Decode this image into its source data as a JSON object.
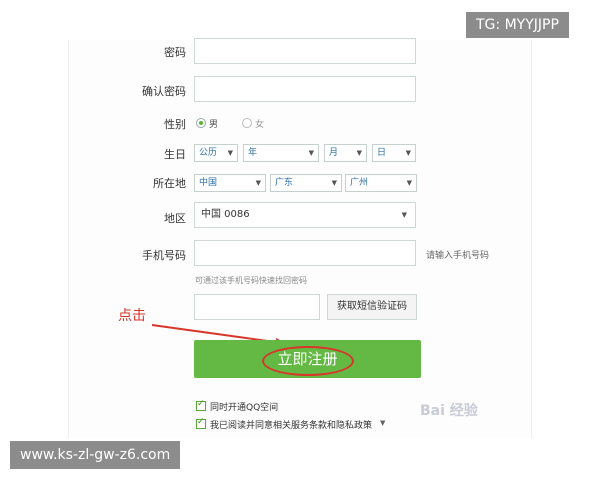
{
  "form": {
    "password_label": "密码",
    "confirm_password_label": "确认密码",
    "gender_label": "性别",
    "gender_male": "男",
    "gender_female": "女",
    "birthday_label": "生日",
    "calendar": "公历",
    "year": "年",
    "month": "月",
    "day": "日",
    "location_label": "所在地",
    "country": "中国",
    "province": "广东",
    "city": "广州",
    "region_label": "地区",
    "region_value": "中国 0086",
    "phone_label": "手机号码",
    "phone_hint": "请输入手机号码",
    "phone_note": "可通过该手机号码快速找回密码",
    "sms_button": "获取短信验证码",
    "register_button": "立即注册",
    "qzone_check": "同时开通QQ空间",
    "agree_check": "我已阅读并同意相关服务条款和隐私政策"
  },
  "annotation": {
    "click_text": "点击",
    "color": "#d9352a"
  },
  "watermarks": {
    "top_right": "TG: MYYJJPP",
    "bottom_left": "www.ks-zl-gw-z6.com",
    "baidu": "Bai  经验"
  },
  "colors": {
    "accent_green": "#63b944",
    "link_blue": "#2b6ea8"
  }
}
